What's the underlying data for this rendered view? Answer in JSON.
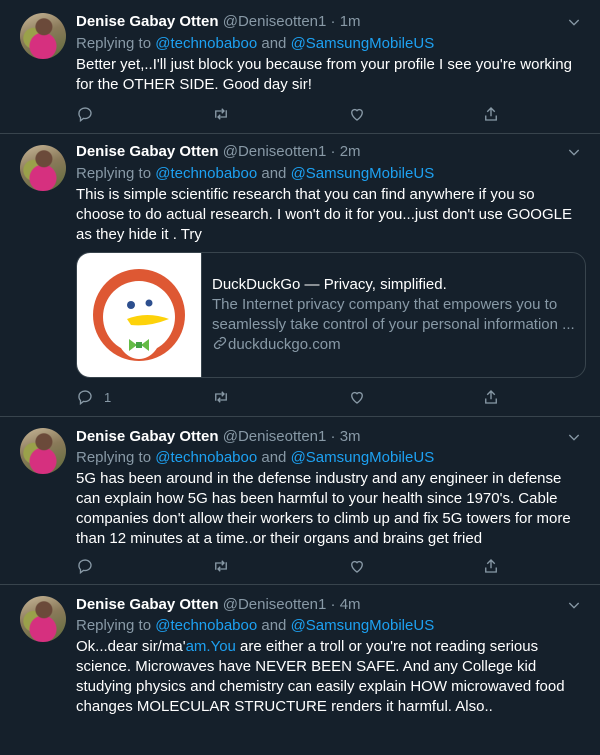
{
  "colors": {
    "background": "#15202b",
    "link": "#1da1f2",
    "muted": "#8899a6",
    "divider": "#38444d"
  },
  "tweets": [
    {
      "name": "Denise Gabay Otten",
      "handle": "@Deniseotten1",
      "dot": "·",
      "time": "1m",
      "replying_prefix": "Replying to ",
      "mention1": "@technobaboo",
      "and": " and ",
      "mention2": "@SamsungMobileUS",
      "text": "Better yet,..I'll just block you because from your profile I see you're working for the OTHER SIDE. Good day sir!",
      "reply_count": ""
    },
    {
      "name": "Denise Gabay Otten",
      "handle": "@Deniseotten1",
      "dot": "·",
      "time": "2m",
      "replying_prefix": "Replying to ",
      "mention1": "@technobaboo",
      "and": " and ",
      "mention2": "@SamsungMobileUS",
      "text": "This is simple scientific research that you can find anywhere if you so choose to do actual research.  I won't do it for you...just don't use GOOGLE as they hide it .  Try",
      "reply_count": "1",
      "card": {
        "title": "DuckDuckGo — Privacy, simplified.",
        "description": "The Internet privacy company that empowers you to seamlessly take control of your personal information ...",
        "domain": "duckduckgo.com"
      }
    },
    {
      "name": "Denise Gabay Otten",
      "handle": "@Deniseotten1",
      "dot": "·",
      "time": "3m",
      "replying_prefix": "Replying to ",
      "mention1": "@technobaboo",
      "and": " and ",
      "mention2": "@SamsungMobileUS",
      "text": "5G has been around in the defense industry and any engineer in defense can explain how 5G has been harmful to your health since 1970's. Cable companies don't allow their workers to climb up and fix 5G towers for more than 12 minutes at a time..or their organs and brains get fried",
      "reply_count": ""
    },
    {
      "name": "Denise Gabay Otten",
      "handle": "@Deniseotten1",
      "dot": "·",
      "time": "4m",
      "replying_prefix": "Replying to ",
      "mention1": "@technobaboo",
      "and": " and ",
      "mention2": "@SamsungMobileUS",
      "text_pre": "Ok...dear sir/ma'",
      "text_link": "am.You",
      "text_post": " are either a troll or you're not reading serious science.  Microwaves have NEVER BEEN SAFE. And any College kid studying physics and chemistry can easily explain HOW microwaved food changes MOLECULAR STRUCTURE renders it harmful. Also..",
      "reply_count": ""
    }
  ]
}
